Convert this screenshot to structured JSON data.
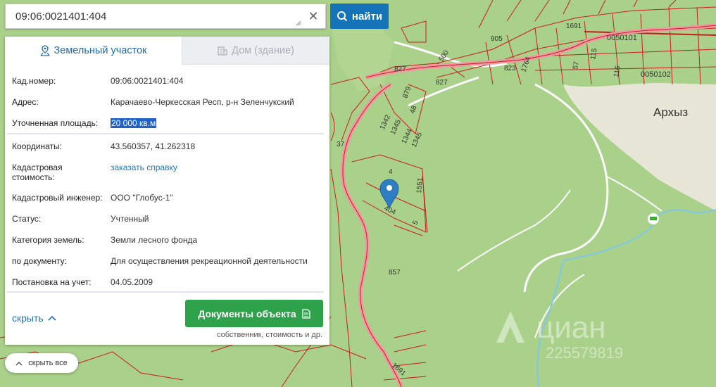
{
  "search": {
    "value": "09:06:0021401:404",
    "find_label": "найти"
  },
  "tabs": [
    {
      "label": "Земельный участок",
      "active": true
    },
    {
      "label": "Дом (здание)",
      "active": false
    }
  ],
  "details": {
    "cadastral_number": {
      "label": "Кад.номер:",
      "value": "09:06:0021401:404"
    },
    "address": {
      "label": "Адрес:",
      "value": "Карачаево-Черкесская Респ, р-н Зеленчукский"
    },
    "area": {
      "label": "Уточненная площадь:",
      "value": "20 000 кв.м"
    },
    "coordinates": {
      "label": "Координаты:",
      "value": "43.560357, 41.262318"
    },
    "cadastral_value": {
      "label_line1": "Кадастровая",
      "label_line2": "стоимость:",
      "value": "заказать справку"
    },
    "engineer": {
      "label": "Кадастровый инженер:",
      "value": "ООО \"Глобус-1\""
    },
    "status": {
      "label": "Статус:",
      "value": "Учтенный"
    },
    "land_category": {
      "label": "Категория земель:",
      "value": "Земли лесного фонда"
    },
    "document_use": {
      "label": "по документу:",
      "value": "Для осуществления рекреационной деятельности"
    },
    "registration": {
      "label": "Постановка на учет:",
      "value": "04.05.2009"
    }
  },
  "actions": {
    "hide": "скрыть",
    "documents_button": "Документы объекта",
    "documents_sub": "собственник, стоимость и др.",
    "hide_all": "скрыть все"
  },
  "map": {
    "village": "Архыз",
    "parcel_labels": [
      "827",
      "827",
      "879",
      "48",
      "1342",
      "1345",
      "1344",
      "1345",
      "37",
      "4",
      "1551",
      "404",
      "5",
      "857",
      "1691",
      "905",
      "500",
      "823",
      "1764",
      "57",
      "1691",
      "0050101",
      "0050102",
      "115",
      "116"
    ]
  },
  "watermark": {
    "brand": "циан",
    "phone": "225579819"
  },
  "colors": {
    "map_green": "#a9d18a",
    "light_green": "#c3dc9c",
    "urban": "#e8e6d6",
    "boundary_red": "#cc1b1b",
    "road_pink": "#ef9aa2",
    "primary_blue": "#1573b8",
    "docs_green": "#2da24a",
    "marker_blue": "#2e7ec4"
  },
  "icons": [
    "search-icon",
    "clear-icon",
    "parcel-tab-icon",
    "building-tab-icon",
    "chevron-up-icon",
    "document-icon",
    "map-marker-icon",
    "hotel-icon"
  ]
}
